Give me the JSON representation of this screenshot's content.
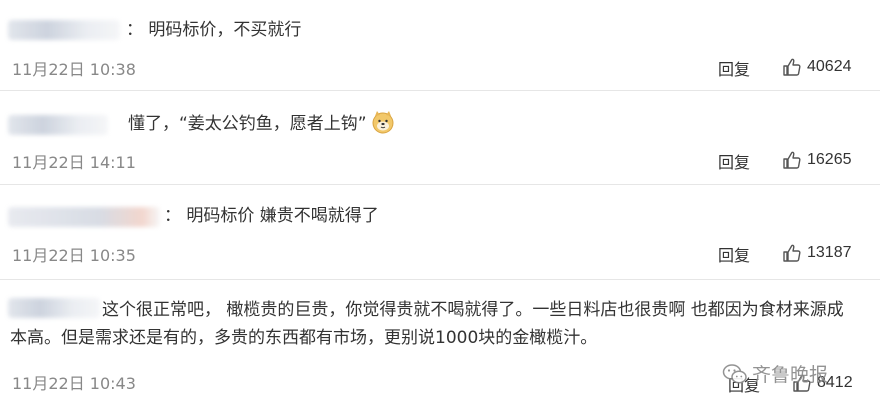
{
  "comments": [
    {
      "text": "：  明码标价，不买就行",
      "time": "11月22日 10:38",
      "reply_label": "回复",
      "likes": "40624"
    },
    {
      "text": "懂了，“姜太公钓鱼，愿者上钩”",
      "time": "11月22日 14:11",
      "reply_label": "回复",
      "likes": "16265",
      "emoji": "doge-emoji"
    },
    {
      "text": "：  明码标价 嫌贵不喝就得了",
      "time": "11月22日 10:35",
      "reply_label": "回复",
      "likes": "13187"
    },
    {
      "text": "这个很正常吧， 橄榄贵的巨贵，你觉得贵就不喝就得了。一些日料店也很贵啊 也都因为食材来源成本高。但是需求还是有的，多贵的东西都有市场，更别说1000块的金橄榄汁。",
      "time": "11月22日 10:43",
      "reply_label": "回复",
      "likes": "8412"
    }
  ],
  "watermark": {
    "text": "齐鲁晚报",
    "icon": "wechat-icon"
  },
  "colors": {
    "text": "#333333",
    "time": "#888888",
    "divider": "#e6e6e6"
  }
}
